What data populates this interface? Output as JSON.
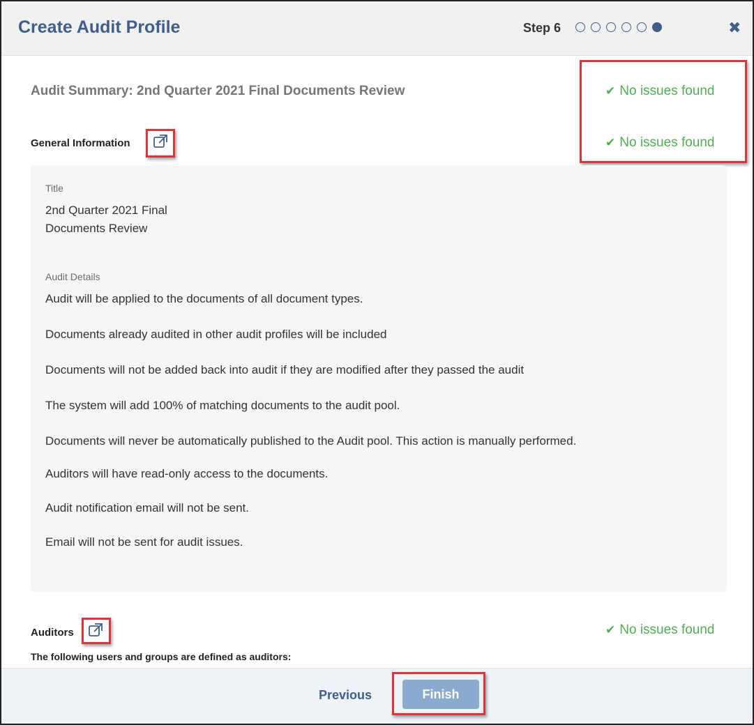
{
  "dialog": {
    "title": "Create Audit Profile",
    "step_label": "Step 6",
    "step_total": 6,
    "step_current": 6,
    "close_icon": "close-icon"
  },
  "summary": {
    "title": "Audit Summary: 2nd Quarter 2021 Final Documents Review",
    "status": "No issues found"
  },
  "general_info": {
    "label": "General Information",
    "status": "No issues found",
    "title_label": "Title",
    "title_line1": "2nd Quarter 2021 Final",
    "title_line2": "Documents Review",
    "details_label": "Audit Details",
    "details": [
      "Audit will be applied to the documents of all document types.",
      "Documents already audited in other audit profiles will be included",
      "Documents will not be added back into audit if they are modified after they passed the audit",
      "The system will add 100% of matching documents to the audit pool.",
      "Documents will never be automatically published to the Audit pool. This action is manually performed.",
      "Auditors will have read-only access to the documents.",
      "Audit notification email will not be sent.",
      "Email will not be sent for audit issues."
    ]
  },
  "auditors": {
    "label": "Auditors",
    "status": "No issues found",
    "subtitle": "The following users and groups are defined as auditors:"
  },
  "footer": {
    "previous_label": "Previous",
    "finish_label": "Finish"
  },
  "colors": {
    "accent": "#3f5e8c",
    "success": "#4caf50",
    "highlight": "#e0333a",
    "finish_button": "#8aaacf"
  }
}
